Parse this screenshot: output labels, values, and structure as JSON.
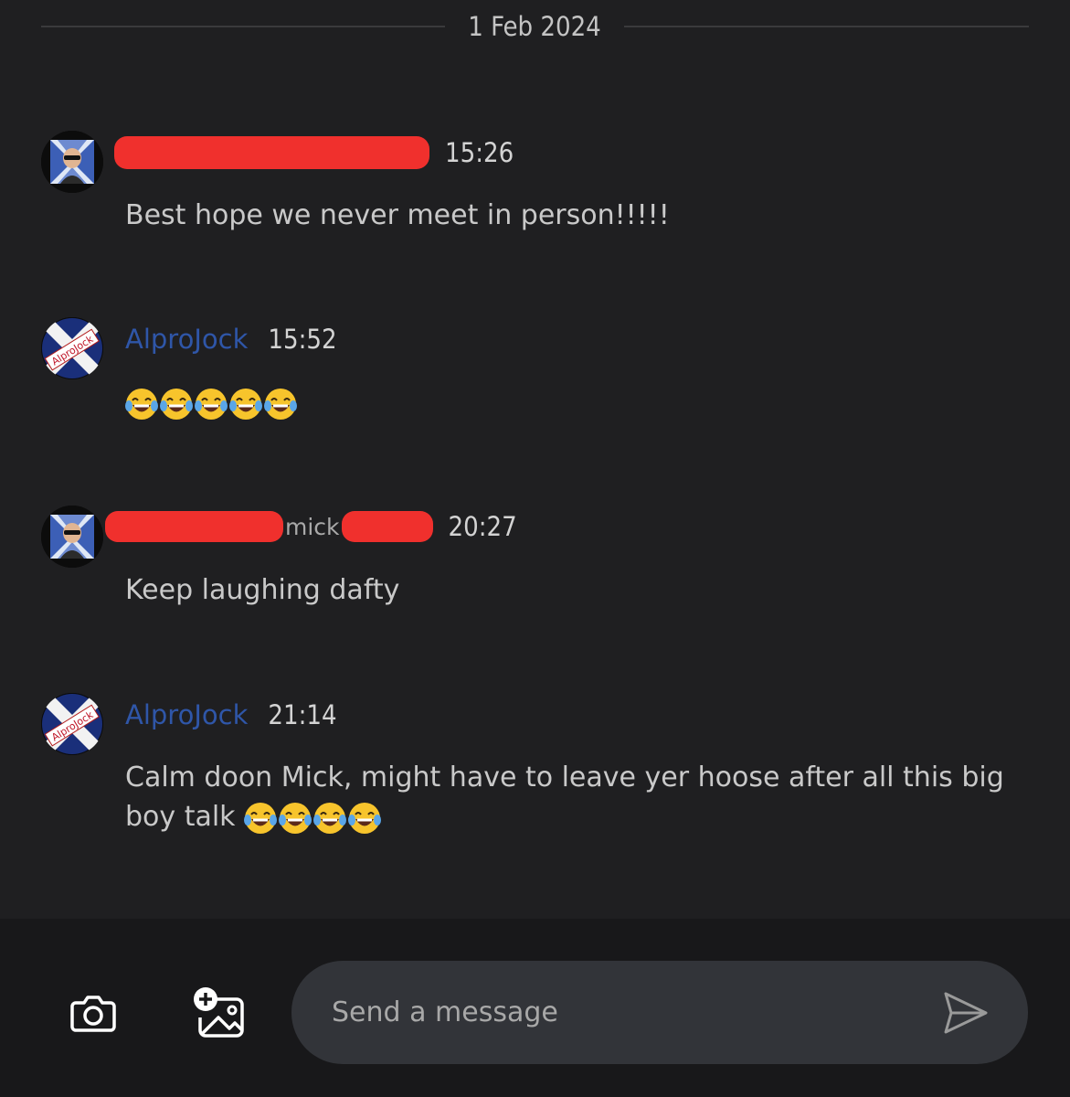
{
  "date_divider": "1 Feb 2024",
  "messages": [
    {
      "username": "",
      "username_redacted": true,
      "time": "15:26",
      "text": "Best hope we never meet in person!!!!!",
      "avatar": "bald-man-sunglasses-avatar"
    },
    {
      "username": "AlproJock",
      "time": "15:52",
      "text": "",
      "emoji_count": 5,
      "avatar": "saltire-flag-avatar"
    },
    {
      "username": "mick",
      "username_redacted": true,
      "time": "20:27",
      "text": "Keep laughing dafty",
      "avatar": "bald-man-sunglasses-avatar"
    },
    {
      "username": "AlproJock",
      "time": "21:14",
      "text": "Calm doon Mick, might have to leave yer hoose after all this big boy talk",
      "emoji_count": 4,
      "avatar": "saltire-flag-avatar"
    }
  ],
  "avatar_flag_text": "AlproJock",
  "composer": {
    "placeholder": "Send a message",
    "camera_icon": "camera-icon",
    "add_image_icon": "add-image-icon",
    "send_icon": "send-icon"
  },
  "colors": {
    "background": "#1f1f21",
    "username_link": "#2f56a8",
    "redaction": "#f0302d",
    "composer_bg": "#18181a",
    "input_bg": "#323439"
  }
}
